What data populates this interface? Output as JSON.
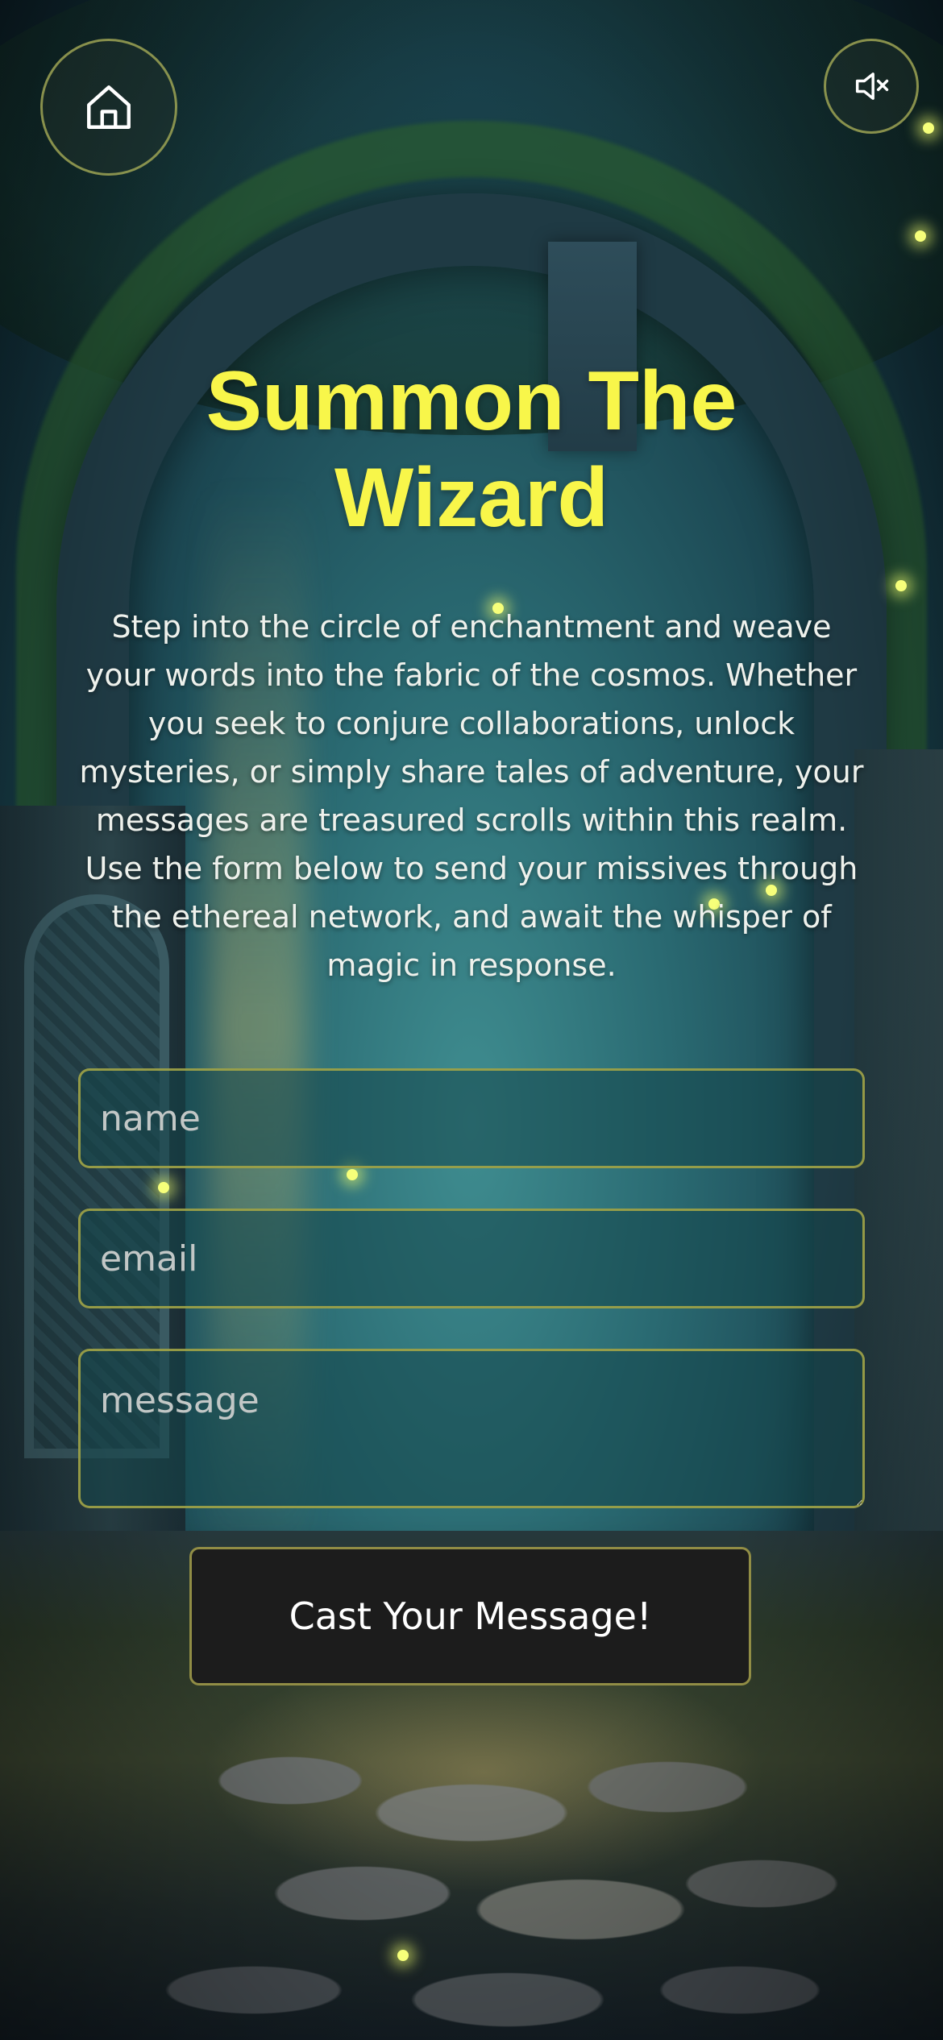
{
  "header": {
    "home_icon": "home-icon",
    "sound_icon": "speaker-muted-icon"
  },
  "hero": {
    "title_line1": "Summon The",
    "title_line2": "Wizard",
    "intro": "Step into the circle of enchantment and weave your words into the fabric of the cosmos. Whether you seek to conjure collaborations, unlock mysteries, or simply share tales of adventure, your messages are treasured scrolls within this realm. Use the form below to send your missives through the ethereal network, and await the whisper of magic in response."
  },
  "form": {
    "name_placeholder": "name",
    "name_value": "",
    "email_placeholder": "email",
    "email_value": "",
    "message_placeholder": "message",
    "message_value": "",
    "submit_label": "Cast Your Message!"
  },
  "colors": {
    "title": "#f8f64a",
    "accent_border": "#aaaa46",
    "button_bg": "#1c1c1c",
    "firefly": "#f6ff7a"
  }
}
